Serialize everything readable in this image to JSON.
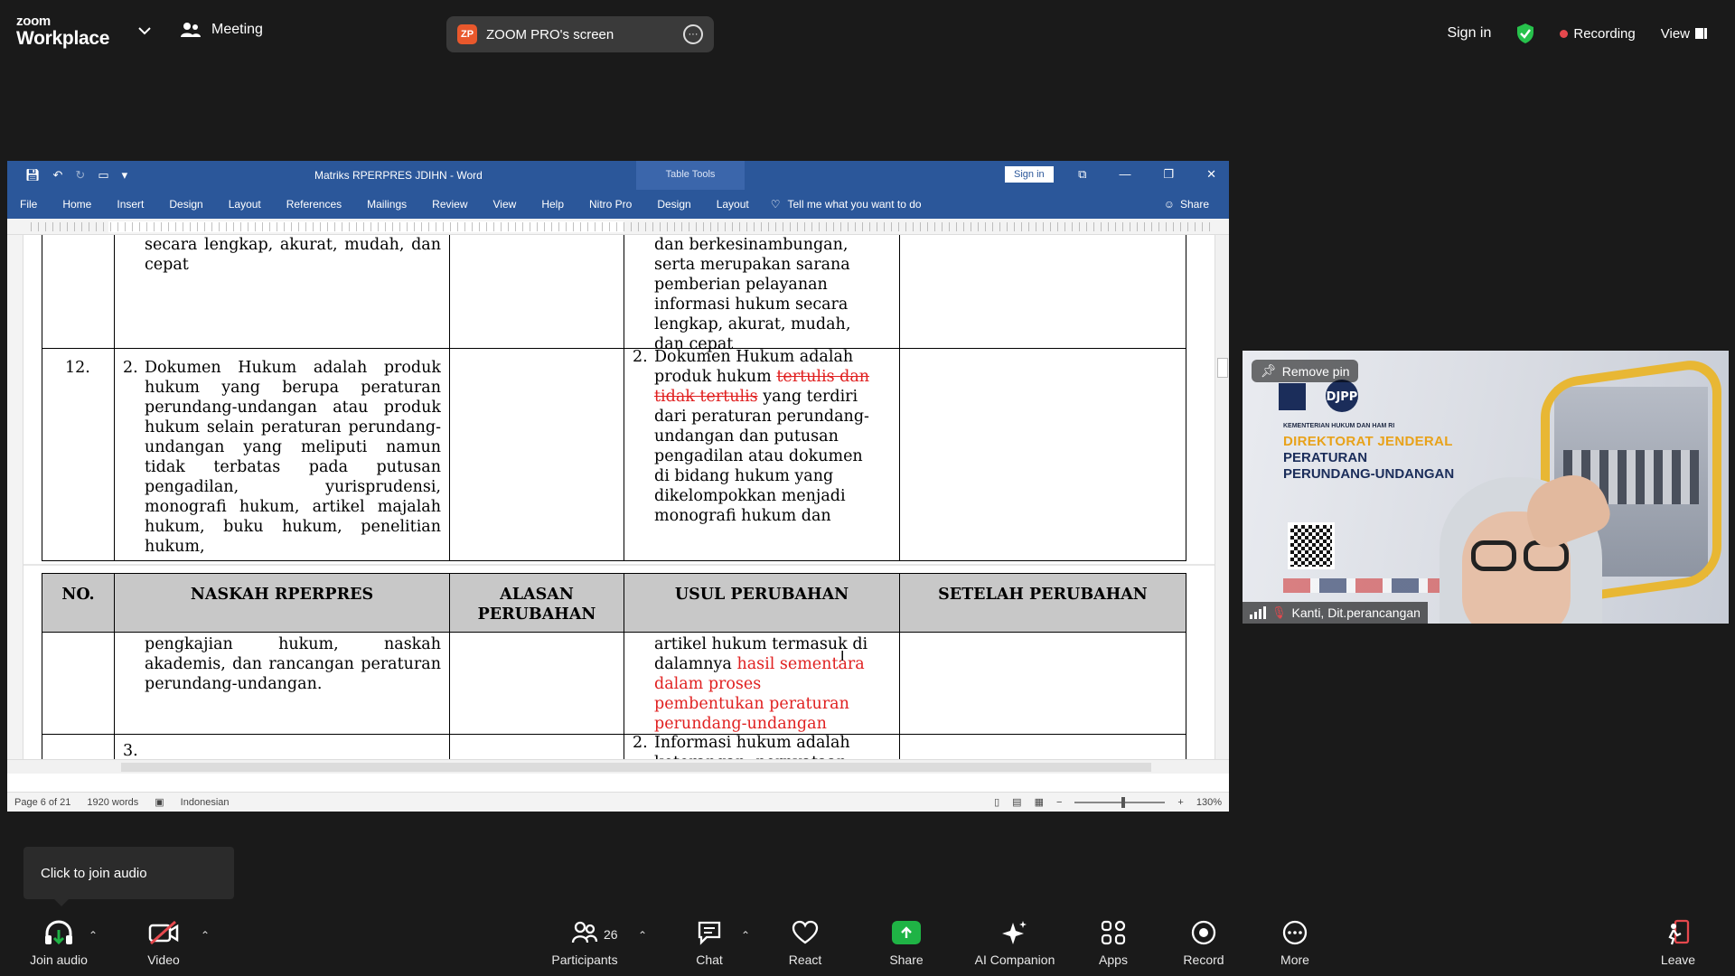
{
  "zoom": {
    "logo_line1": "zoom",
    "logo_line2": "Workplace",
    "meeting_label": "Meeting",
    "share_badge": "ZP",
    "share_title": "ZOOM PRO's screen",
    "sign_in": "Sign in",
    "recording": "Recording",
    "view": "View",
    "tooltip": "Click to join audio",
    "toolbar": {
      "join_audio": "Join audio",
      "video": "Video",
      "participants": "Participants",
      "participants_count": "26",
      "chat": "Chat",
      "react": "React",
      "share": "Share",
      "ai_companion": "AI Companion",
      "apps": "Apps",
      "record": "Record",
      "more": "More",
      "leave": "Leave"
    },
    "video_tile": {
      "pin_label": "Remove pin",
      "participant_name": "Kanti, Dit.perancangan",
      "bg_org": "KEMENTERIAN HUKUM DAN HAM RI",
      "bg_title1": "DIREKTORAT JENDERAL",
      "bg_title2": "PERATURAN",
      "bg_title3": "PERUNDANG-UNDANGAN",
      "bg_logo": "DJPP"
    }
  },
  "word": {
    "doc_title": "Matriks RPERPRES JDIHN  -  Word",
    "table_tools": "Table Tools",
    "sign_in": "Sign in",
    "tabs": [
      "File",
      "Home",
      "Insert",
      "Design",
      "Layout",
      "References",
      "Mailings",
      "Review",
      "View",
      "Help",
      "Nitro Pro",
      "Design",
      "Layout"
    ],
    "tell_me": "Tell me what you want to do",
    "share": "Share",
    "status": {
      "page": "Page 6 of 21",
      "words": "1920 words",
      "language": "Indonesian",
      "zoom": "130%"
    },
    "table": {
      "headers": [
        "NO.",
        "NASKAH RPERPRES",
        "ALASAN PERUBAHAN",
        "USUL PERUBAHAN",
        "SETELAH PERUBAHAN"
      ],
      "top_left_text": "secara lengkap, akurat, mudah, dan cepat",
      "top_right_text": "dan berkesinambungan, serta merupakan sarana pemberian pelayanan informasi hukum secara lengkap, akurat, mudah, dan cepat",
      "row12_no": "12.",
      "row12_item": "2.",
      "row12_naskah": "Dokumen Hukum adalah produk hukum yang berupa peraturan perundang-undangan atau produk hukum selain peraturan perundang-undangan yang meliputi namun tidak terbatas pada putusan pengadilan, yurisprudensi, monografi hukum, artikel majalah hukum, buku hukum, penelitian hukum,",
      "row12_usul_item": "2.",
      "row12_usul_a": "Dokumen Hukum adalah produk hukum",
      "row12_usul_strike": "tertulis dan tidak tertulis",
      "row12_usul_b": "yang terdiri dari peraturan perundang-undangan dan putusan pengadilan atau dokumen di bidang hukum yang dikelompokkan menjadi monografi hukum dan",
      "cont_naskah": "pengkajian hukum, naskah akademis, dan rancangan peraturan perundang-undangan.",
      "cont_usul_a": "artikel hukum termasuk di dalamnya",
      "cont_usul_red": "hasil sementara dalam proses pembentukan peraturan perundang-undangan",
      "row3_item": "3.",
      "row3_usul_item": "2.",
      "row3_usul_text": "Informasi hukum adalah keterangan, pernyataan"
    }
  }
}
